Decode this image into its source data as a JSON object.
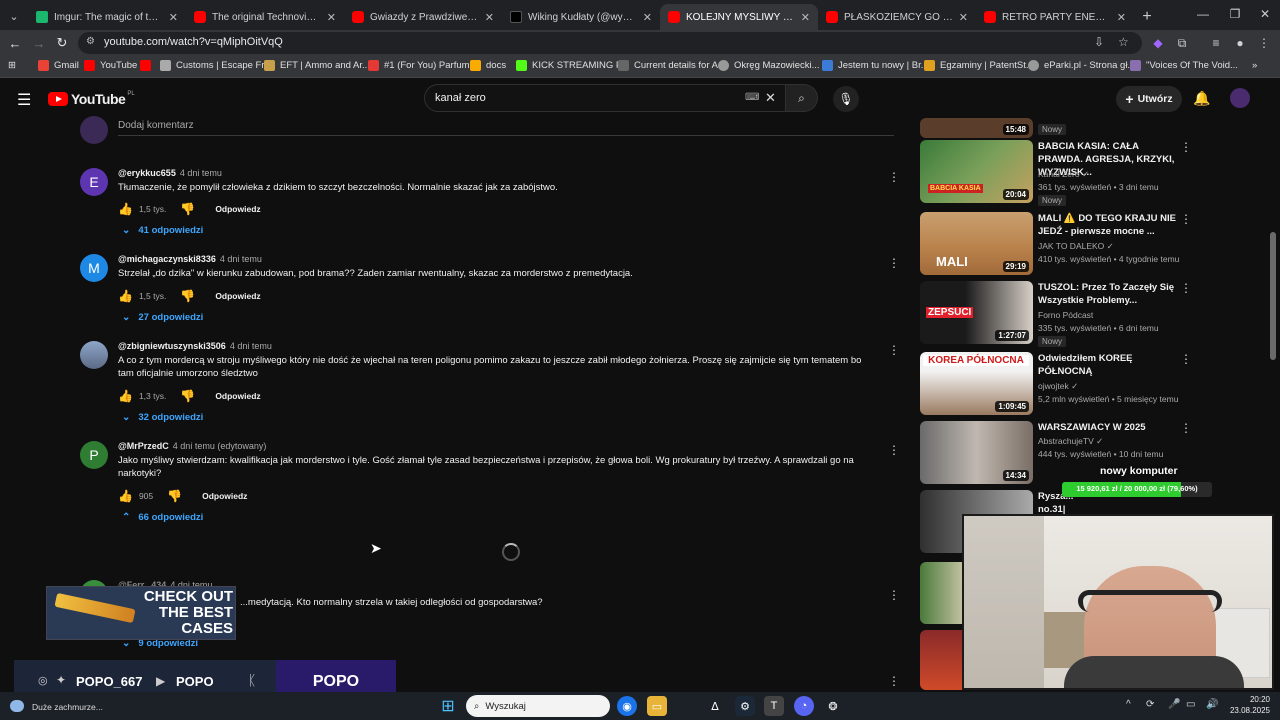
{
  "browser": {
    "tabs": [
      {
        "title": "Imgur: The magic of the Interne",
        "icon": "imgur",
        "active": false
      },
      {
        "title": "The original Technoviking video",
        "icon": "youtube",
        "active": false
      },
      {
        "title": "Gwiazdy z Prawdziwego Lombar",
        "icon": "youtube",
        "active": false
      },
      {
        "title": "Wiking Kudłaty (@wychudzony",
        "icon": "tiktok",
        "active": false
      },
      {
        "title": "KOLEJNY MYŚLIWY ZASTRZELIŁ",
        "icon": "youtube",
        "active": true
      },
      {
        "title": "PŁASKOZIEMCY GO NIENAWIDZ",
        "icon": "youtube",
        "active": false
      },
      {
        "title": "RETRO PARTY ENERGY 2000 PR",
        "icon": "youtube",
        "active": false
      }
    ],
    "url": "youtube.com/watch?v=qMiphOitVqQ",
    "bookmarks": [
      "Gmail",
      "YouTube",
      "",
      "Customs | Escape Fr...",
      "EFT | Ammo and Ar...",
      "#1 (For You) Parfum...",
      "docs",
      "KICK STREAMING P...",
      "Current details for A...",
      "Okręg Mazowiecki...",
      "Jestem tu nowy | Br...",
      "Egzaminy | PatentSt...",
      "eParki.pl - Strona gł...",
      "\"Voices Of The Void..."
    ]
  },
  "youtube": {
    "logo_text": "YouTube",
    "region": "PL",
    "search_query": "kanał zero",
    "create_label": "Utwórz",
    "add_comment_placeholder": "Dodaj komentarz"
  },
  "comments": [
    {
      "author": "@erykkuc655",
      "time": "4 dni temu",
      "text": "Tłumaczenie, że pomylił człowieka z dzikiem to szczyt bezczelności. Normalnie skazać jak za zabójstwo.",
      "likes": "1,5 tys.",
      "reply": "Odpowiedz",
      "replies": "41 odpowiedzi",
      "avatar_letter": "E",
      "avatar_color": "#5e35b1"
    },
    {
      "author": "@michagaczynski8336",
      "time": "4 dni temu",
      "text": "Strzelał „do dzika\" w kierunku zabudowan, pod brama?? Zaden zamiar rwentualny, skazac za morderstwo z premedytacja.",
      "likes": "1,5 tys.",
      "reply": "Odpowiedz",
      "replies": "27 odpowiedzi",
      "avatar_letter": "M",
      "avatar_color": "#1e88e5"
    },
    {
      "author": "@zbigniewtuszynski3506",
      "time": "4 dni temu",
      "text": "A co z tym mordercą w stroju myśliwego który nie dość że wjechał na teren poligonu pomimo zakazu to jeszcze zabił młodego żołnierza.  Proszę się zajmijcie się tym tematem bo tam oficjalnie umorzono śledztwo",
      "likes": "1,3 tys.",
      "reply": "Odpowiedz",
      "replies": "32 odpowiedzi",
      "avatar_letter": "",
      "avatar_color": "#6a7a9a"
    },
    {
      "author": "@MrPrzedC",
      "time": "4 dni temu (edytowany)",
      "text": "Jako myśliwy stwierdzam: kwalifikacja jak morderstwo i tyle. Gość złamał tyle zasad bezpieczeństwa i przepisów, że głowa boli.  Wg prokuratury był trzeźwy. A sprawdzali go na narkotyki?",
      "likes": "905",
      "reply": "Odpowiedz",
      "replies": "66 odpowiedzi",
      "avatar_letter": "P",
      "avatar_color": "#2e7d32"
    },
    {
      "author": "@Ferr...434",
      "time": "4 dni temu",
      "text": "...medytacją. Kto normalny strzela w takiej odległości od gospodarstwa?",
      "replies": "9 odpowiedzi"
    }
  ],
  "recommendations": [
    {
      "title": "",
      "duration": "15:48",
      "channel": "",
      "meta": "",
      "badge": "Nowy"
    },
    {
      "title": "BABCIA KASIA: CAŁA PRAWDA. AGRESJA, KRZYKI, WYZWISK...",
      "duration": "20:04",
      "channel": "Kanał Zero",
      "meta": "361 tys. wyświetleń • 3 dni temu",
      "badge": "Nowy",
      "thumb_text": "BABCIA KASIA"
    },
    {
      "title": "MALI ⚠️ DO TEGO KRAJU NIE JEDŹ - pierwsze mocne ...",
      "duration": "29:19",
      "channel": "JAK TO DALEKO",
      "meta": "410 tys. wyświetleń • 4 tygodnie temu",
      "badge": "",
      "thumb_text": "MALI"
    },
    {
      "title": "TUSZOL: Przez To Zaczęły  Się Wszystkie Problemy...",
      "duration": "1:27:07",
      "channel": "Forno Pódcast",
      "meta": "335 tys. wyświetleń • 6 dni temu",
      "badge": "Nowy",
      "thumb_text": "ZEPSUCI"
    },
    {
      "title": "Odwiedziłem KOREĘ PÓŁNOCNĄ",
      "duration": "1:09:45",
      "channel": "ojwojtek",
      "meta": "5,2 mln wyświetleń • 5 miesięcy temu",
      "badge": "",
      "thumb_text": "KOREA PÓŁNOCNA"
    },
    {
      "title": "WARSZAWIACY W 2025",
      "duration": "14:34",
      "channel": "AbstrachujeTV",
      "meta": "444 tys. wyświetleń • 10 dni temu",
      "badge": "",
      "thumb_text": ""
    },
    {
      "title": "Rysza... no.31| Stand-up | Impro | ...",
      "duration": "",
      "channel": "",
      "meta": "",
      "badge": ""
    }
  ],
  "overlay": {
    "goal_title": "nowy komputer",
    "goal_progress": "15 920,61 zł / 20 000,00 zł (79,60%)",
    "goal_fraction": 0.796,
    "case_banner_line1": "CHECK OUT",
    "case_banner_line2": "THE BEST",
    "case_banner_line3": "CASES",
    "handle_social": "POPO_667",
    "handle_youtube": "POPO",
    "brand": "POPO"
  },
  "taskbar": {
    "weather": "Duże zachmurze...",
    "search_placeholder": "Wyszukaj",
    "time": "20:20",
    "date": "23.08.2025"
  }
}
